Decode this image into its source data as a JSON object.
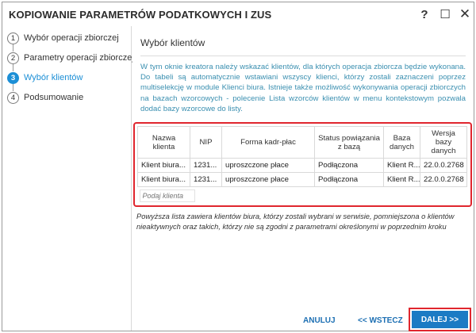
{
  "window": {
    "title": "KOPIOWANIE PARAMETRÓW PODATKOWYCH I ZUS",
    "help_label": "?",
    "maximize_label": "☐",
    "close_label": "✕"
  },
  "steps": [
    {
      "num": "1",
      "label": "Wybór operacji zbiorczej",
      "active": false
    },
    {
      "num": "2",
      "label": "Parametry operacji zbiorczej",
      "active": false
    },
    {
      "num": "3",
      "label": "Wybór klientów",
      "active": true
    },
    {
      "num": "4",
      "label": "Podsumowanie",
      "active": false
    }
  ],
  "content": {
    "section_title": "Wybór klientów",
    "info": "W tym oknie kreatora należy wskazać klientów, dla których operacja zbiorcza będzie wykonana. Do tabeli są automatycznie wstawiani wszyscy klienci, którzy zostali zaznaczeni poprzez multiselekcję w module Klienci biura. Istnieje także możliwość wykonywania operacji zbiorczych na bazach wzorcowych - polecenie Lista wzorców klientów w menu kontekstowym pozwala dodać bazy wzorcowe do listy.",
    "note": "Powyższa lista zawiera klientów biura, którzy zostali wybrani w serwisie, pomniejszona o klientów nieaktywnych oraz takich, którzy nie są zgodni z parametrami określonymi w poprzednim kroku"
  },
  "table": {
    "columns": [
      "Nazwa klienta",
      "NIP",
      "Forma kadr-płac",
      "Status powiązania z bazą",
      "Baza danych",
      "Wersja bazy danych"
    ],
    "rows": [
      [
        "Klient biura...",
        "1231...",
        "uproszczone płace",
        "Podłączona",
        "Klient R...",
        "22.0.0.2768"
      ],
      [
        "Klient biura...",
        "1231...",
        "uproszczone płace",
        "Podłączona",
        "Klient R...",
        "22.0.0.2768"
      ]
    ],
    "add_placeholder": "Podaj klienta"
  },
  "footer": {
    "cancel_label": "ANULUJ",
    "back_label": "<< WSTECZ",
    "next_label": "DALEJ >>"
  },
  "colors": {
    "accent": "#1c8fd6",
    "primary_button": "#1b7bc4",
    "highlight": "#e0262e",
    "info_text": "#3a8fb0"
  }
}
